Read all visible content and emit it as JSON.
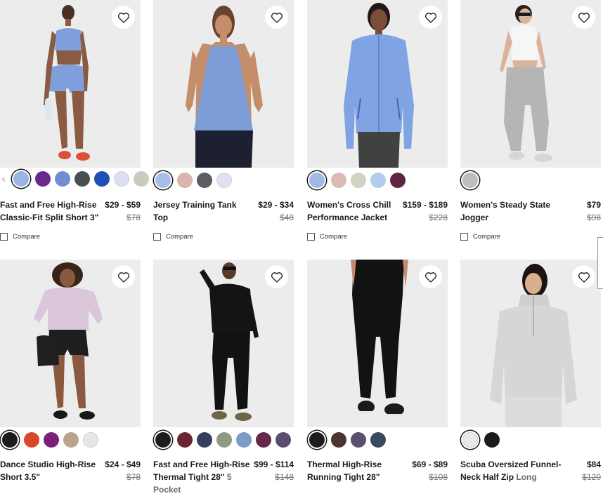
{
  "compare_label": "Compare",
  "products": [
    {
      "name": "Fast and Free High-Rise Classic-Fit Split Short 3\"",
      "sub": "",
      "price": "$29 - $59",
      "original_price": "$78",
      "swatches": [
        "#9bb4e6",
        "#6a2a8c",
        "#6f8fd0",
        "#4a4f4f",
        "#1f4fb3",
        "#dcdff2",
        "#c8ccbf"
      ],
      "selected_swatch": 0,
      "has_arrows": true,
      "image": "woman-blue-bra-shorts"
    },
    {
      "name": "Jersey Training Tank Top",
      "sub": "",
      "price": "$29 - $34",
      "original_price": "$48",
      "swatches": [
        "#a9bde8",
        "#d9b5ae",
        "#5a5d62",
        "#dfe1f2"
      ],
      "selected_swatch": 0,
      "has_arrows": false,
      "image": "woman-blue-tank"
    },
    {
      "name": "Women's Cross Chill Performance Jacket",
      "sub": "",
      "price": "$159 - $189",
      "original_price": "$228",
      "swatches": [
        "#a4b9e8",
        "#dbbab3",
        "#cfd3c2",
        "#b2ccee",
        "#5e2442"
      ],
      "selected_swatch": 0,
      "has_arrows": false,
      "image": "woman-blue-jacket"
    },
    {
      "name": "Women's Steady State Jogger",
      "sub": "",
      "price": "$79",
      "original_price": "$98",
      "swatches": [
        "#bdbdbd"
      ],
      "selected_swatch": 0,
      "has_arrows": false,
      "image": "woman-grey-jogger"
    },
    {
      "name": "Dance Studio High-Rise Short 3.5\"",
      "sub": "",
      "price": "$24 - $49",
      "original_price": "$78",
      "swatches": [
        "#1c1c1c",
        "#d9472b",
        "#7d1f7a",
        "#b8a68c",
        "#e6e6e6"
      ],
      "selected_swatch": 0,
      "has_arrows": false,
      "image": "woman-pink-jacket-black-shorts"
    },
    {
      "name": "Fast and Free High-Rise Thermal Tight 28\"",
      "sub": "5 Pocket",
      "price": "$99 - $114",
      "original_price": "$148",
      "swatches": [
        "#1c1c1c",
        "#6b2430",
        "#34405e",
        "#8e9a86",
        "#7c9bc9",
        "#64284a",
        "#5a4d70"
      ],
      "selected_swatch": 0,
      "has_arrows": false,
      "image": "woman-black-jacket-tights"
    },
    {
      "name": "Thermal High-Rise Running Tight 28\"",
      "sub": "",
      "price": "$69 - $89",
      "original_price": "$108",
      "swatches": [
        "#1c1c1c",
        "#4a3530",
        "#5a5070",
        "#3a4a5e"
      ],
      "selected_swatch": 0,
      "has_arrows": false,
      "image": "legs-black-tights"
    },
    {
      "name": "Scuba Oversized Funnel-Neck Half Zip",
      "sub": "Long",
      "price": "$84",
      "original_price": "$120",
      "swatches": [
        "#e9e9e9",
        "#1c1c1c"
      ],
      "selected_swatch": 0,
      "has_arrows": false,
      "image": "woman-grey-half-zip"
    }
  ],
  "icons": {
    "favorite": "heart-icon",
    "prev": "chevron-left-icon",
    "next": "chevron-right-icon"
  }
}
